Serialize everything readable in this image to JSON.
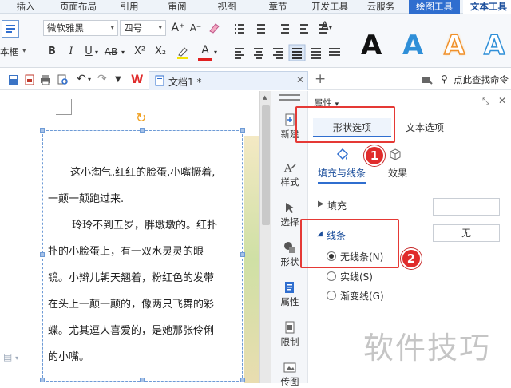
{
  "ribbon_tabs": [
    "插入",
    "页面布局",
    "引用",
    "审阅",
    "视图",
    "章节",
    "开发工具",
    "云服务",
    "绘图工具",
    "文本工具"
  ],
  "ribbon": {
    "style_label": "本框",
    "font_name": "微软雅黑",
    "font_size": "四号",
    "bold": "B",
    "italic": "I",
    "underline": "U",
    "strike": "AB",
    "superscript": "X²",
    "subscript": "X₂",
    "font_color_label": "A",
    "grow": "A⁺",
    "shrink": "A⁻",
    "wordart_letters": [
      "A",
      "A",
      "A",
      "A"
    ]
  },
  "quick_bar": {
    "doc_tab_title": "文档1 *",
    "add_tab": "+",
    "search_hint": "点此查找命令"
  },
  "document": {
    "paragraphs": [
      "这小淘气,红红的脸蛋,小嘴撅着,",
      "一颠一颠跑过来.",
      "玲玲不到五岁，胖墩墩的。红扑",
      "扑的小脸蛋上，有一双水灵灵的眼",
      "镜。小辫儿朝天翘着，粉红色的发带",
      "在头上一颠一颠的，像两只飞舞的彩",
      "蝶。尤其逗人喜爱的，是她那张伶俐",
      "的小嘴。"
    ]
  },
  "side_strip": [
    "新建",
    "样式",
    "选择",
    "形状",
    "属性",
    "限制",
    "传图"
  ],
  "panel": {
    "title": "属性",
    "tab_shape": "形状选项",
    "tab_text": "文本选项",
    "sub_fill_line": "填充与线条",
    "sub_effect": "效果",
    "section_fill": "填充",
    "section_line": "线条",
    "line_value": "无",
    "options": [
      {
        "label": "无线条(N)",
        "selected": true
      },
      {
        "label": "实线(S)",
        "selected": false
      },
      {
        "label": "渐变线(G)",
        "selected": false
      }
    ],
    "badge_1": "1",
    "badge_2": "2"
  },
  "watermark": "软件技巧",
  "colors": {
    "accent": "#2f6ecf",
    "highlight_red": "#e53935",
    "wordart_black": "#111111",
    "wordart_blue": "#2f8fd8",
    "wordart_orange": "#f0902a"
  }
}
